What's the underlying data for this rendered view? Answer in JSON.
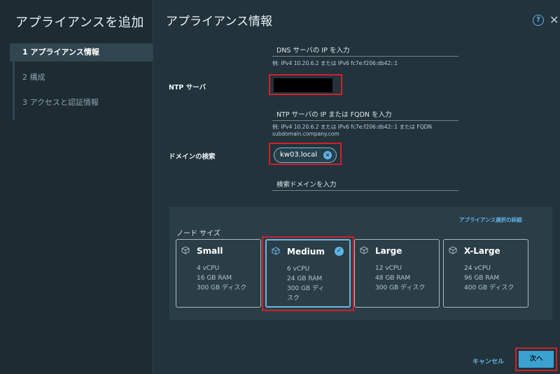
{
  "sidebar": {
    "title": "アプライアンスを追加",
    "steps": [
      {
        "label": "1  アプライアンス情報",
        "active": true
      },
      {
        "label": "2  構成",
        "active": false
      },
      {
        "label": "3  アクセスと認証情報",
        "active": false
      }
    ]
  },
  "header": {
    "title": "アプライアンス情報",
    "help_glyph": "?",
    "close_glyph": "✕"
  },
  "dns": {
    "placeholder": "DNS サーバの IP を入力",
    "hint": "例: IPv4 10.20.6.2 または IPv6 fc7e:f206:db42::1"
  },
  "ntp": {
    "label": "NTP サーバ",
    "value_redacted": true,
    "placeholder": "NTP サーバの IP または FQDN を入力",
    "hint_line1": "例: IPv4 10.20.6.2 または IPv6 fc7e:f206:db42::1 または FQDN",
    "hint_line2": "subdomain.company.com"
  },
  "domain_search": {
    "label": "ドメインの検索",
    "chip_value": "kw03.local",
    "chip_remove_glyph": "×",
    "placeholder": "検索ドメインを入力"
  },
  "node_size": {
    "label": "ノード サイズ",
    "detail_link": "アプライアンス選択の詳細",
    "selected": "Medium",
    "cards": [
      {
        "name": "Small",
        "cpu": "4 vCPU",
        "ram": "16 GB RAM",
        "disk": "300 GB ディスク"
      },
      {
        "name": "Medium",
        "cpu": "6 vCPU",
        "ram": "24 GB RAM",
        "disk_line1": "300 GB ディ",
        "disk_line2": "スク"
      },
      {
        "name": "Large",
        "cpu": "12 vCPU",
        "ram": "48 GB RAM",
        "disk": "300 GB ディスク"
      },
      {
        "name": "X-Large",
        "cpu": "24 vCPU",
        "ram": "96 GB RAM",
        "disk": "400 GB ディスク"
      }
    ],
    "check_glyph": "✓"
  },
  "footer": {
    "cancel_label": "キャンセル",
    "next_label": "次へ"
  },
  "colors": {
    "accent": "#5fb3e6",
    "primary_button": "#3aa2d3",
    "highlight_box": "#d0202a"
  }
}
